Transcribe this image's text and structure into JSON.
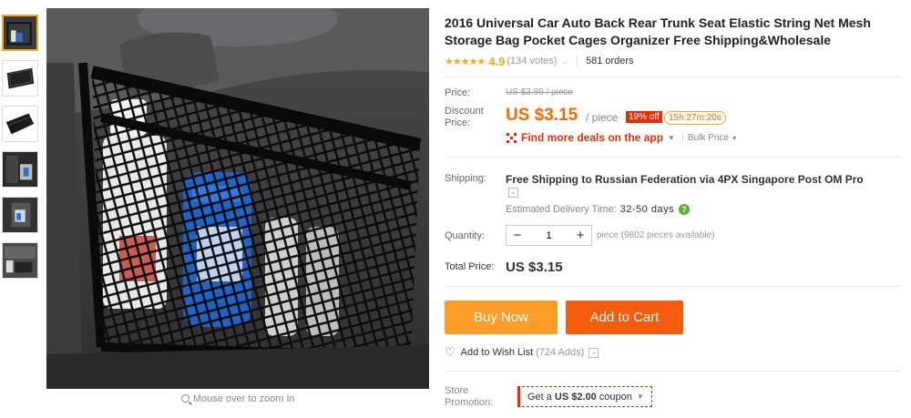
{
  "thumbnails": [
    {
      "name": "thumb-1"
    },
    {
      "name": "thumb-2"
    },
    {
      "name": "thumb-3"
    },
    {
      "name": "thumb-4"
    },
    {
      "name": "thumb-5"
    },
    {
      "name": "thumb-6"
    }
  ],
  "gallery": {
    "zoom_hint": "Mouse over to zoom in"
  },
  "product": {
    "title": "2016 Universal Car Auto Back Rear Trunk Seat Elastic String Net Mesh Storage Bag Pocket Cages Organizer Free Shipping&Wholesale",
    "stars": "★★★★★",
    "rating": "4.9",
    "votes": "(134 votes)",
    "orders": "581 orders"
  },
  "price": {
    "price_label": "Price:",
    "original": "US $3.89 / piece",
    "discount_label": "Discount Price:",
    "discount": "US $3.15",
    "unit": "/ piece",
    "off_badge": "19% off",
    "timer": "15h:27m:20s",
    "deals_link": "Find more deals on the app",
    "bulk_price": "Bulk Price"
  },
  "shipping": {
    "label": "Shipping:",
    "text": "Free Shipping to Russian Federation via 4PX Singapore Post OM Pro",
    "eta_label": "Estimated Delivery Time:",
    "eta_value": "32-50 days"
  },
  "quantity": {
    "label": "Quantity:",
    "value": "1",
    "minus": "−",
    "plus": "+",
    "note": "piece (9802 pieces available)"
  },
  "total": {
    "label": "Total Price:",
    "value": "US $3.15"
  },
  "actions": {
    "buy_now": "Buy Now",
    "add_to_cart": "Add to Cart",
    "wish_label": "Add to Wish List",
    "wish_count": "(724 Adds)"
  },
  "promotion": {
    "label": "Store Promotion:",
    "coupon_prefix": "Get a",
    "coupon_amount": "US $2.00",
    "coupon_suffix": "coupon"
  },
  "colors": {
    "accent_orange": "#f60",
    "buy_now_bg": "#fc9d2a",
    "add_cart_bg": "#f45d0d",
    "badge_red": "#e62e04",
    "star": "#f5a623"
  }
}
